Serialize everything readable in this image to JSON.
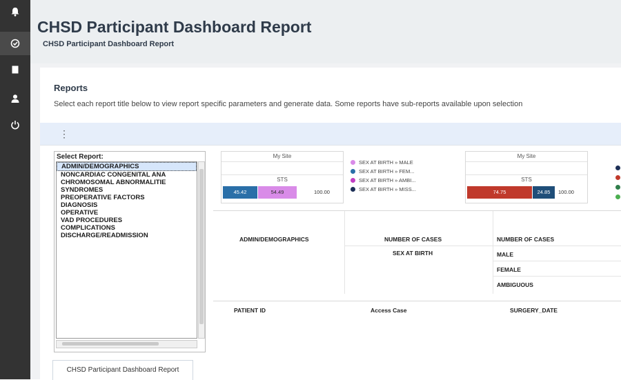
{
  "sidebar": {
    "icons": [
      "bell-icon",
      "check-circle-icon",
      "document-icon",
      "user-icon",
      "power-icon"
    ]
  },
  "header": {
    "title": "CHSD Participant Dashboard Report",
    "subtitle": "CHSD Participant Dashboard Report"
  },
  "reports": {
    "title": "Reports",
    "description": "Select each report title below to view report specific parameters and generate data. Some reports have sub-reports available upon selection"
  },
  "select_report": {
    "label": "Select Report:",
    "items": [
      "ADMIN/DEMOGRAPHICS",
      "NONCARDIAC CONGENITAL ANA",
      "CHROMOSOMAL ABNORMALITIE",
      "SYNDROMES",
      "PREOPERATIVE FACTORS",
      "DIAGNOSIS",
      "OPERATIVE",
      "VAD PROCEDURES",
      "COMPLICATIONS",
      "DISCHARGE/READMISSION"
    ],
    "selected": "ADMIN/DEMOGRAPHICS"
  },
  "chart1": {
    "top_label": "My Site",
    "bottom_label": "STS",
    "segments": [
      {
        "value": "45.42",
        "color": "#2a6fa8"
      },
      {
        "value": "54.49",
        "color": "#d98be8"
      }
    ],
    "total": "100.00",
    "legend": [
      {
        "label": "SEX AT BIRTH » MALE",
        "color": "#d98be8"
      },
      {
        "label": "SEX AT BIRTH » FEM...",
        "color": "#2a6fa8"
      },
      {
        "label": "SEX AT BIRTH » AMBI...",
        "color": "#c23fc4"
      },
      {
        "label": "SEX AT BIRTH » MISS...",
        "color": "#1d2f57"
      }
    ]
  },
  "chart2": {
    "top_label": "My Site",
    "bottom_label": "STS",
    "segments": [
      {
        "value": "74.75",
        "color": "#c0392b"
      },
      {
        "value": "24.85",
        "color": "#1f4e79"
      }
    ],
    "total": "100.00",
    "legend_colors": [
      "#1d2f57",
      "#c0392b",
      "#2f7d4a",
      "#4caf50"
    ]
  },
  "table": {
    "col1_header": "ADMIN/DEMOGRAPHICS",
    "col2_header": "NUMBER OF CASES",
    "col2_sub": "SEX AT BIRTH",
    "col3_header": "NUMBER OF CASES",
    "col3_rows": [
      "MALE",
      "FEMALE",
      "AMBIGUOUS"
    ]
  },
  "patient_columns": [
    "PATIENT ID",
    "Access Case",
    "SURGERY_DATE"
  ],
  "bottom_tab": "CHSD Participant Dashboard Report"
}
